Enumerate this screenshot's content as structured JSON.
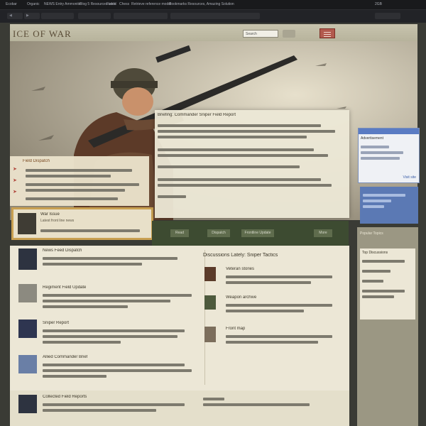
{
  "topbar": {
    "tabs": [
      "Ecobar",
      "Organic",
      "NEWS Entry Ammonite",
      "Blog 5 Resources used",
      "Fields",
      "Chess",
      "Retrieve reference model",
      "Bookmarks Resources, Amazing Solution",
      "2GB"
    ]
  },
  "header": {
    "logo": "ICE OF WAR",
    "search_placeholder": "Search",
    "search_button": "",
    "menu_icon": "hamburger-icon"
  },
  "hero": {
    "panel_title": "Briefing: Commander Sniper Field Report",
    "left_panel_title": "Field Dispatch",
    "feature_title": "War Issue",
    "feature_sub": "Latest front line news"
  },
  "green_band": {
    "buttons": [
      "Read",
      "Dispatch",
      "Frontline Update",
      "More"
    ]
  },
  "content": {
    "left_items": [
      "News Feed Dispatch",
      "Regiment Field Update",
      "Sniper Report",
      "Allied Commander Brief"
    ],
    "right_head": "Discussions Lately: Sniper Tactics",
    "right_items": [
      "Veteran stories",
      "Weapon archive",
      "Front map"
    ],
    "bottom_caption": "Collected Field Reports"
  },
  "ad": {
    "title": "Advertisement",
    "link": "Visit site"
  },
  "sidebar": {
    "heading": "Popular Topics",
    "subheading": "Top Discussions"
  },
  "colors": {
    "accent_red": "#b25a4e",
    "accent_blue": "#5b79b4",
    "band_green": "#3d4b31",
    "feature_border": "#c9a051"
  }
}
